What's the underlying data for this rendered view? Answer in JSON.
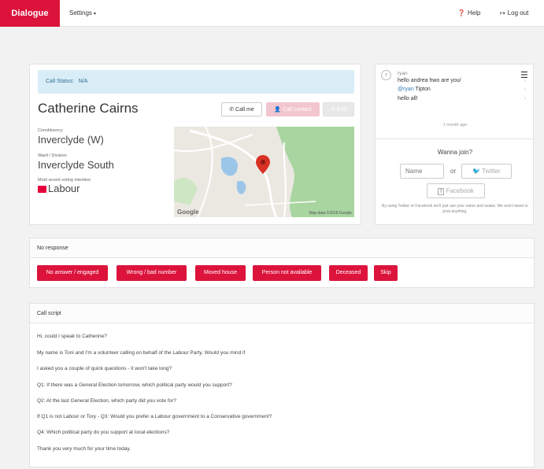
{
  "nav": {
    "brand": "Dialogue",
    "settings": "Settings",
    "help": "Help",
    "logout": "Log out"
  },
  "contact": {
    "status_label": "Call Status:",
    "status_value": "N/A",
    "name": "Catherine Cairns",
    "buttons": {
      "call_me": "Call me",
      "call_contact": "Call contact",
      "end": "End"
    },
    "constituency_label": "Constituency",
    "constituency": "Inverclyde (W)",
    "ward_label": "Ward / Division",
    "ward": "Inverclyde South",
    "voting_label": "Most recent voting intention",
    "voting": "Labour",
    "map": {
      "credit": "Map data ©2018 Google",
      "logo": "Google"
    }
  },
  "chat": {
    "avatar_letter": "r",
    "user": "ryan",
    "messages": [
      {
        "text": "hello andrea hwo are you/"
      },
      {
        "mention": "@ryan",
        "text": " Tipton"
      },
      {
        "text": "hello all!"
      }
    ],
    "time": "1 month ago",
    "wanna_join": "Wanna join?",
    "name_placeholder": "Name",
    "or": "or",
    "twitter": "Twitter",
    "facebook": "Facebook",
    "note": "By using Twitter or Facebook we'll just use your name and avatar. We won't tweet or post anything."
  },
  "no_response": {
    "title": "No response",
    "buttons": [
      "No answer / engaged",
      "Wrong / bad number",
      "Moved house",
      "Person not available",
      "Deceased",
      "Skip"
    ]
  },
  "call_script": {
    "title": "Call script",
    "lines": [
      "Hi, could I speak to Catherine?",
      "My name is Toni and I'm a volunteer calling on behalf of the Labour Party. Would you mind if",
      "I asked you a couple of quick questions - it won't take long?",
      "Q1: If there was a General Election tomorrow, which political party would you support?",
      "Q2: At the last General Election, which party did you vote for?",
      "If Q1 is not Labour or Tory - Q3: Would you prefer a Labour government to a Conservative government?",
      "Q4: Which political party do you support at local elections?",
      "Thank you very much for your time today."
    ]
  },
  "colors": {
    "brand": "#dc143c",
    "info": "#d9edf7"
  }
}
